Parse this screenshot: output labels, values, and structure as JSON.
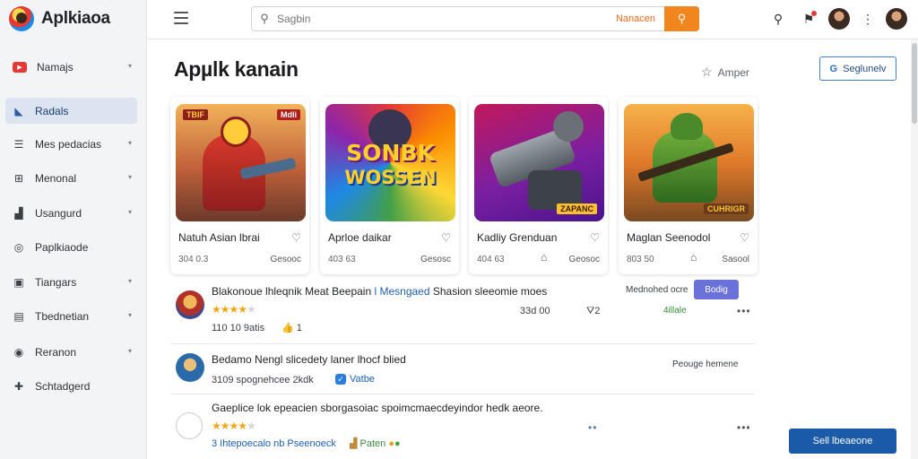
{
  "brand": {
    "name": "Aplkiaoa"
  },
  "sidebar": {
    "items": [
      {
        "label": "Namajs",
        "icon": "youtube-icon",
        "glyph": "▶",
        "chevron": true,
        "active": false
      },
      {
        "label": "Radals",
        "icon": "chart-icon",
        "glyph": "◣",
        "chevron": false,
        "active": true
      },
      {
        "label": "Mes pedacias",
        "icon": "list-icon",
        "glyph": "☰",
        "chevron": true,
        "active": false
      },
      {
        "label": "Menonal",
        "icon": "grid-icon",
        "glyph": "⊞",
        "chevron": true,
        "active": false
      },
      {
        "label": "Usangurd",
        "icon": "bar-chart-icon",
        "glyph": "▟",
        "chevron": true,
        "active": false
      },
      {
        "label": "Paplkiaode",
        "icon": "circle-icon",
        "glyph": "◎",
        "chevron": false,
        "active": false
      },
      {
        "label": "Tiangars",
        "icon": "image-icon",
        "glyph": "▣",
        "chevron": true,
        "active": false
      },
      {
        "label": "Tbednetian",
        "icon": "book-icon",
        "glyph": "▤",
        "chevron": true,
        "active": false
      },
      {
        "label": "Reranon",
        "icon": "info-icon",
        "glyph": "◉",
        "chevron": true,
        "active": false
      },
      {
        "label": "Schtadgerd",
        "icon": "puzzle-icon",
        "glyph": "✚",
        "chevron": false,
        "active": false
      }
    ]
  },
  "topbar": {
    "search_placeholder": "Sagbin",
    "search_suffix": "Nanacen"
  },
  "main": {
    "title": "Apµlk kanain",
    "amper_label": "Amper",
    "signup_label": "Seglunelv"
  },
  "cards": [
    {
      "name": "Natuh Asian lbrai",
      "size": "304 0.3",
      "mid": "",
      "btn": "Gesooc",
      "tag": "Mdli",
      "tag2": "TBIF"
    },
    {
      "name": "Aprloe daikar",
      "size": "403 63",
      "mid": "",
      "btn": "Gesosc",
      "art_line1": "SONBK",
      "art_line2": "WOSSEN"
    },
    {
      "name": "Kadliy Grenduan",
      "size": "404 63",
      "mid": "⌂",
      "btn": "Geosoc",
      "tag": "ZAPANC"
    },
    {
      "name": "Maglan Seenodol",
      "size": "803 50",
      "mid": "⌂",
      "btn": "Sasool",
      "tag": "CUHRIGR"
    }
  ],
  "rows": [
    {
      "title_plain": "Blakonoue lhleqnik Meat Beepain ",
      "title_blue": "l Mesngaed",
      "title_rest": " Shasion sleeomie moes",
      "stars": 4,
      "meta_left": "110  10 9atis",
      "meta_icon": "👍 1",
      "meta_mid": "33d 00",
      "meta_num": "⛛2",
      "right_label": "Mednohed ocre",
      "badge": "Bodig",
      "right_small": "4illale"
    },
    {
      "title_plain": "Bedamo Nengl slicedety laner lhocf blied",
      "sub_text": "3109 spognehcee 2kdk",
      "sub_link": "Vatbe",
      "right_label": "Peouge hemene"
    },
    {
      "title_plain": "Gaeplice lok epeacien sborgasoiac spoimcmaecdeyindor hedk aeore.",
      "stars": 4,
      "sub_text": "3 Ihtepoecalo nb Pseenoeck",
      "sub_right": "Paten"
    }
  ],
  "cta_label": "Sell lbeaeone"
}
